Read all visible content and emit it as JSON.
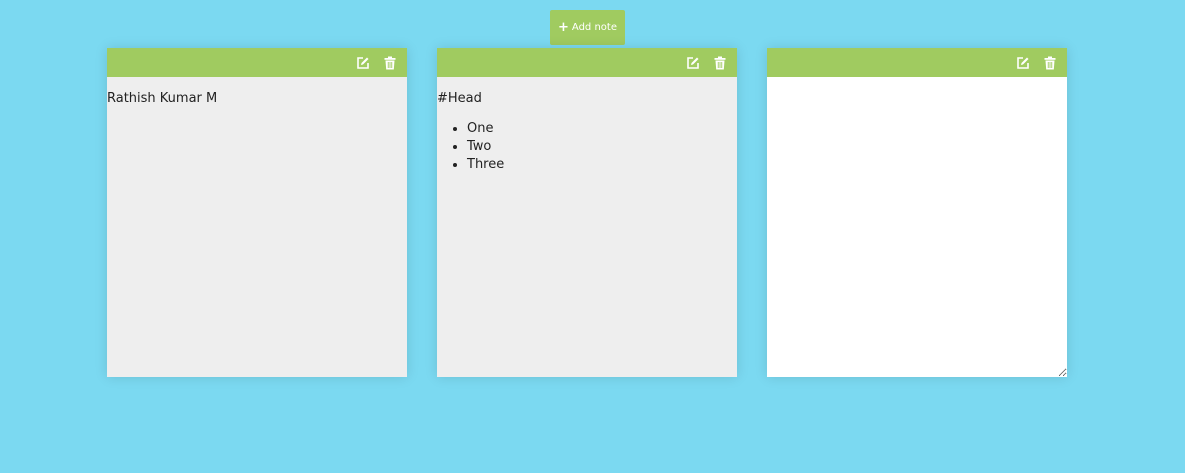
{
  "app": {
    "add_button_label": "Add note",
    "add_button_icon": "plus-icon"
  },
  "colors": {
    "background": "#7bd9f1",
    "note_header": "#a0cb60",
    "note_body": "#eeeeee",
    "edit_area": "#ffffff"
  },
  "notes": [
    {
      "mode": "view",
      "tools": [
        "edit-icon",
        "trash-icon"
      ],
      "text": "Rathish Kumar M"
    },
    {
      "mode": "view",
      "tools": [
        "edit-icon",
        "trash-icon"
      ],
      "heading": "#Head",
      "items": [
        "One",
        "Two",
        "Three"
      ]
    },
    {
      "mode": "edit",
      "tools": [
        "edit-icon",
        "trash-icon"
      ],
      "textarea_value": ""
    }
  ]
}
